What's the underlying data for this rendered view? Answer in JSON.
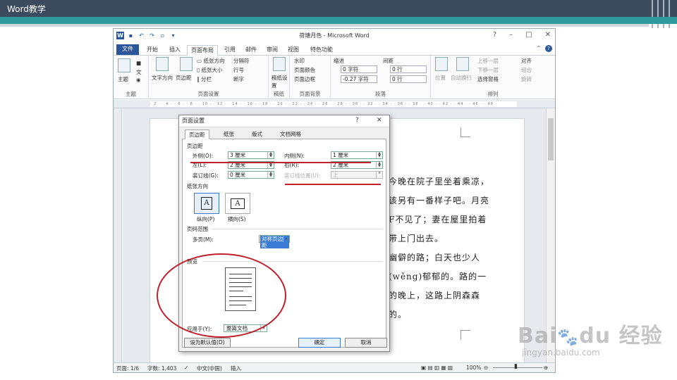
{
  "slide": {
    "title": "Word教学"
  },
  "word": {
    "title": "荷塘月色 - Microsoft Word",
    "tabs": [
      "文件",
      "开始",
      "插入",
      "页面布局",
      "引用",
      "邮件",
      "审阅",
      "视图",
      "特色功能"
    ],
    "active_tab": "页面布局",
    "ribbon": {
      "theme": {
        "label": "主题",
        "group": "主题"
      },
      "page_setup": {
        "text_direction": "文字方向",
        "margins": "页边距",
        "orientation": "纸张方向",
        "size": "纸张大小",
        "columns": "分栏",
        "breaks": "分隔符",
        "line_numbers": "行号",
        "hyphenation": "断字",
        "group": "页面设置"
      },
      "draft": {
        "label": "稿纸设置",
        "group": "稿纸"
      },
      "page_background": {
        "watermark": "水印",
        "page_color": "页面颜色",
        "page_borders": "页面边框",
        "group": "页面背景"
      },
      "paragraph": {
        "indent": "缩进",
        "spacing": "间距",
        "indent_left": "0 字符",
        "indent_right": "-0.27 字符",
        "spacing_before": "0 行",
        "spacing_after": "0 行",
        "group": "段落"
      },
      "arrange": {
        "position": "位置",
        "wrap": "自动换行",
        "bring_forward": "上移一层",
        "send_backward": "下移一层",
        "selection_pane": "选择窗格",
        "align": "对齐",
        "group_btn": "组合",
        "rotate": "旋转",
        "group": "排列"
      }
    },
    "document_lines": [
      "今晚在院子里坐着乘凉，",
      "该另有一番样子吧。月亮",
      "F不见了；妻在屋里拍着",
      "带上门出去。",
      "幽僻的路；白天也少人",
      "(wěng)郁郁的。路的一",
      "的晚上，这路上阴森森",
      "的。"
    ],
    "status": {
      "page": "页面: 1/6",
      "words": "字数: 1,403",
      "language": "中文(中国)",
      "mode": "插入",
      "zoom": "100%"
    }
  },
  "dialog": {
    "title": "页面设置",
    "help": "?",
    "close": "✕",
    "tabs": [
      "页边距",
      "纸张",
      "版式",
      "文档网格"
    ],
    "active_tab": "页边距",
    "margins_section": "页边距",
    "outer_label": "外侧(O):",
    "outer_value": "3 厘米",
    "inner_label": "内侧(N):",
    "inner_value": "1 厘米",
    "top_label": "左(L):",
    "top_value": "2 厘米",
    "bottom_label": "右(R):",
    "bottom_value": "2 厘米",
    "gutter_label": "装订线(G):",
    "gutter_value": "0 厘米",
    "gutter_pos_label": "装订线位置(U):",
    "gutter_pos_value": "上",
    "orientation_section": "纸张方向",
    "portrait_label": "纵向(P)",
    "landscape_label": "横向(S)",
    "pages_section": "页码范围",
    "multiple_pages_label": "多页(M):",
    "multiple_pages_value": "对称页边距",
    "preview_section": "预览",
    "apply_to_label": "应用于(Y):",
    "apply_to_value": "整篇文档",
    "set_default": "设为默认值(D)",
    "ok": "确定",
    "cancel": "取消"
  },
  "watermark": {
    "brand": "Baidu经验",
    "url": "jingyan.baidu.com"
  },
  "colors": {
    "accent": "#2b579a",
    "annotation": "#c0202a",
    "slide_bar": "#3b4a5c",
    "teal": "#2f9b9e"
  }
}
